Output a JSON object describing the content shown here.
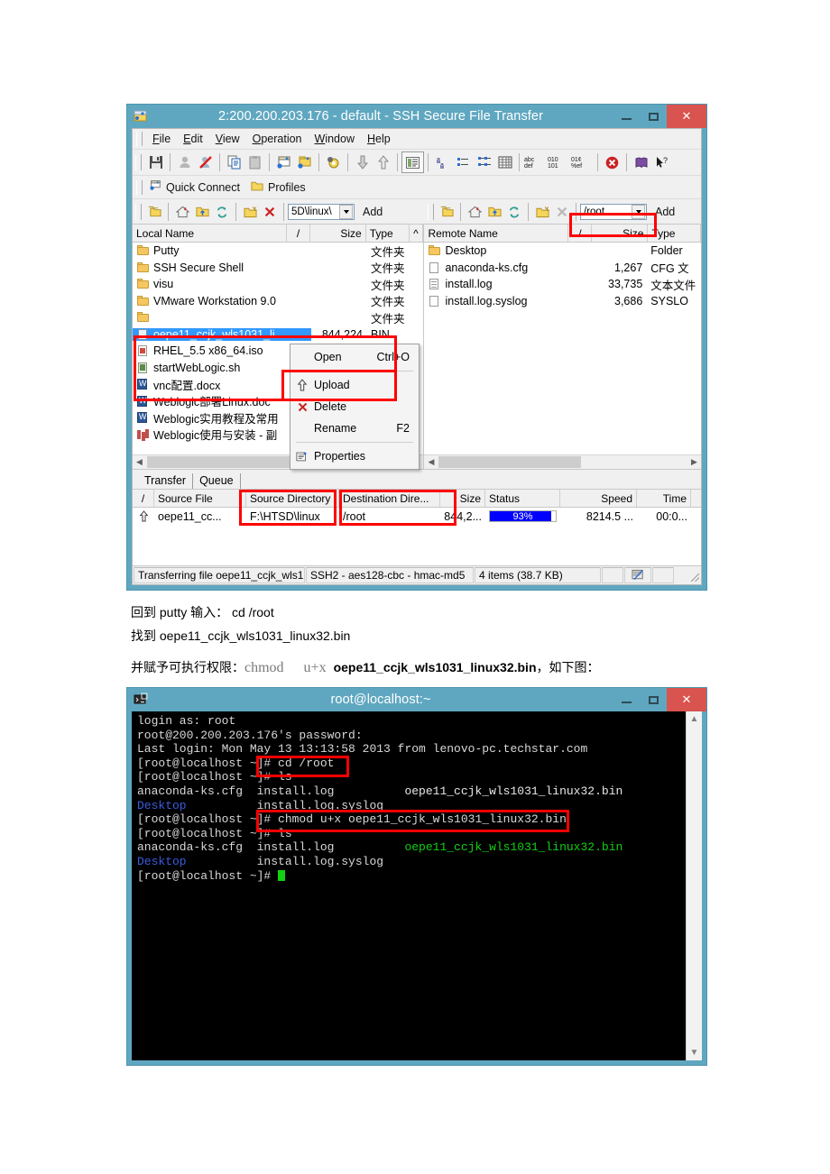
{
  "ftp_window": {
    "title": "2:200.200.203.176 - default - SSH Secure File Transfer",
    "icon": "ssh-file-transfer-icon",
    "buttons": {
      "minimize": "–",
      "maximize": "□",
      "close": "✕"
    },
    "menu": [
      "File",
      "Edit",
      "View",
      "Operation",
      "Window",
      "Help"
    ],
    "quickbar": {
      "connect": "Quick Connect",
      "profiles": "Profiles"
    },
    "toolbar_icons": [
      "save-icon",
      "disconnect-icon",
      "disconnect-slash-icon",
      "copy-icon",
      "paste-icon",
      "new-local-window-icon",
      "new-remote-window-icon",
      "settings-icon",
      "download-arrow-icon",
      "upload-arrow-icon",
      "list-view-icon",
      "small-icons-icon",
      "list-icon",
      "details-icon",
      "grid-icon",
      "ascii-icon",
      "binary-icon",
      "auto-transfer-icon",
      "stop-icon",
      "help-book-icon",
      "context-help-icon"
    ],
    "local": {
      "path_value": "5D\\linux\\",
      "add_label": "Add",
      "columns": [
        "Local Name",
        "/",
        "Size",
        "Type"
      ],
      "rows": [
        {
          "name": "Putty",
          "size": "",
          "type": "文件夹",
          "icon": "folder-icon"
        },
        {
          "name": "SSH Secure Shell",
          "size": "",
          "type": "文件夹",
          "icon": "folder-icon"
        },
        {
          "name": "visu",
          "size": "",
          "type": "文件夹",
          "icon": "folder-icon"
        },
        {
          "name": "VMware Workstation 9.0",
          "size": "",
          "type": "文件夹",
          "icon": "folder-icon"
        },
        {
          "name": "",
          "size": "",
          "type": "文件夹",
          "icon": "folder-icon"
        },
        {
          "name": "oepe11_ccjk_wls1031_li..",
          "size": "844,224",
          "type": "BIN",
          "icon": "file-blue-icon",
          "selected": true
        },
        {
          "name": "RHEL_5.5 x86_64.iso",
          "size": "",
          "type": "",
          "icon": "iso-icon"
        },
        {
          "name": "startWebLogic.sh",
          "size": "",
          "type": "",
          "icon": "sh-icon"
        },
        {
          "name": "vnc配置.docx",
          "size": "",
          "type": "",
          "icon": "word-icon"
        },
        {
          "name": "Weblogic部署Linux.doc",
          "size": "",
          "type": "",
          "icon": "word-icon"
        },
        {
          "name": "Weblogic实用教程及常用",
          "size": "",
          "type": "",
          "icon": "word-icon"
        },
        {
          "name": "Weblogic使用与安装 - 副",
          "size": "",
          "type": "",
          "icon": "ppt-icon"
        }
      ]
    },
    "remote": {
      "path_value": "/root",
      "add_label": "Add",
      "columns": [
        "Remote Name",
        "/",
        "Size",
        "Type"
      ],
      "rows": [
        {
          "name": "Desktop",
          "size": "",
          "type": "Folder",
          "icon": "folder-icon"
        },
        {
          "name": "anaconda-ks.cfg",
          "size": "1,267",
          "type": "CFG 文",
          "icon": "file-icon"
        },
        {
          "name": "install.log",
          "size": "33,735",
          "type": "文本文件",
          "icon": "file-lines-icon"
        },
        {
          "name": "install.log.syslog",
          "size": "3,686",
          "type": "SYSLO",
          "icon": "file-icon"
        }
      ]
    },
    "context_menu": {
      "items": [
        {
          "label": "Open",
          "accel": "Ctrl+O",
          "icon": ""
        },
        {
          "label": "Upload",
          "accel": "",
          "icon": "upload-arrow-icon",
          "highlighted": true
        },
        {
          "label": "Delete",
          "accel": "",
          "icon": "delete-x-icon"
        },
        {
          "label": "Rename",
          "accel": "F2",
          "icon": ""
        },
        {
          "label": "Properties",
          "accel": "",
          "icon": "properties-icon"
        }
      ]
    },
    "transfer": {
      "tabs": [
        "Transfer",
        "Queue"
      ],
      "columns": [
        "/",
        "Source File",
        "Source Directory",
        "Destination Dire...",
        "Size",
        "Status",
        "Speed",
        "Time"
      ],
      "rows": [
        {
          "direction_icon": "upload-arrow-icon",
          "source_file": "oepe11_cc...",
          "source_dir": "F:\\HTSD\\linux",
          "dest_dir": "/root",
          "size": "844,2...",
          "status_percent": 93,
          "status_label": "93%",
          "speed": "8214.5 ...",
          "time": "00:0..."
        }
      ]
    },
    "statusbar": {
      "message": "Transferring file oepe11_ccjk_wls1",
      "cipher": "SSH2 - aes128-cbc - hmac-md5",
      "items": "4 items (38.7 KB)",
      "transfer_icon": "transfer-status-icon"
    }
  },
  "body_text": {
    "line1": "回到 putty 输入： cd /root",
    "line2": "找到 oepe11_ccjk_wls1031_linux32.bin",
    "line3_prefix": "并赋予可执行权限：",
    "line3_cmd": "chmod",
    "line3_flag": "u+x",
    "line3_file": "oepe11_ccjk_wls1031_linux32.bin",
    "line3_suffix": "，如下图："
  },
  "terminal_window": {
    "title": "root@localhost:~",
    "icon": "putty-icon",
    "buttons": {
      "minimize": "–",
      "maximize": "□",
      "close": "✕"
    },
    "lines": [
      "login as: root",
      "root@200.200.203.176's password:",
      "Last login: Mon May 13 13:13:58 2013 from lenovo-pc.techstar.com",
      "[root@localhost ~]# cd /root",
      "[root@localhost ~]# ls",
      "anaconda-ks.cfg  install.log          oepe11_ccjk_wls1031_linux32.bin",
      "Desktop          install.log.syslog",
      "[root@localhost ~]# chmod u+x oepe11_ccjk_wls1031_linux32.bin",
      "[root@localhost ~]# ls",
      "anaconda-ks.cfg  install.log          oepe11_ccjk_wls1031_linux32.bin",
      "Desktop          install.log.syslog",
      "[root@localhost ~]# "
    ],
    "highlight_cd": "cd /root",
    "highlight_chmod": "# chmod u+x oepe11_ccjk_wls1031_linux32.bin"
  },
  "colors": {
    "window_frame": "#5fa7c0",
    "close_button": "#d9534f",
    "annotation": "#ff0000",
    "selection": "#3399ff",
    "progress": "#0000ff",
    "terminal_bg": "#000000",
    "terminal_green": "#12d012",
    "terminal_blue": "#3b5ce0"
  }
}
